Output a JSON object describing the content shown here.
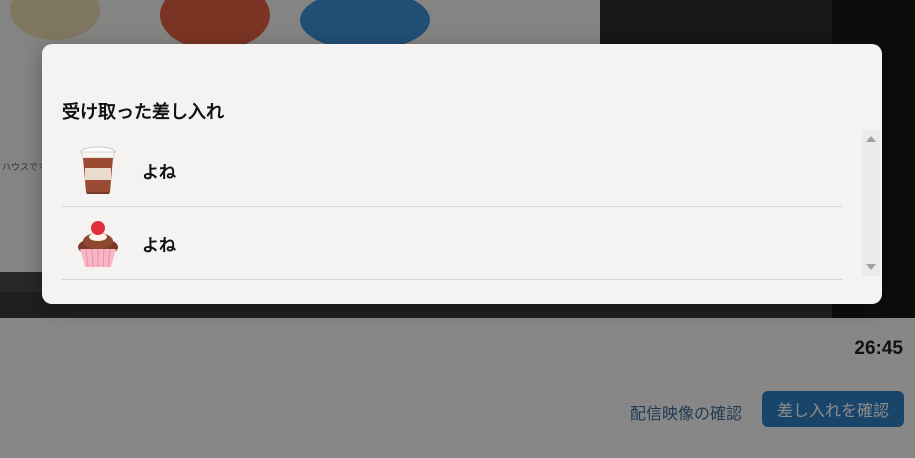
{
  "background": {
    "page_text": "ハウスでマ",
    "timer": "26:45",
    "confirm_video_label": "配信映像の確認",
    "confirm_gifts_label": "差し入れを確認"
  },
  "modal": {
    "title": "受け取った差し入れ",
    "items": [
      {
        "icon": "coffee-cup-icon",
        "sender": "よね"
      },
      {
        "icon": "cupcake-icon",
        "sender": "よね"
      }
    ]
  },
  "colors": {
    "primary_button": "#2f7fc1",
    "modal_bg": "#f4f3f1"
  }
}
